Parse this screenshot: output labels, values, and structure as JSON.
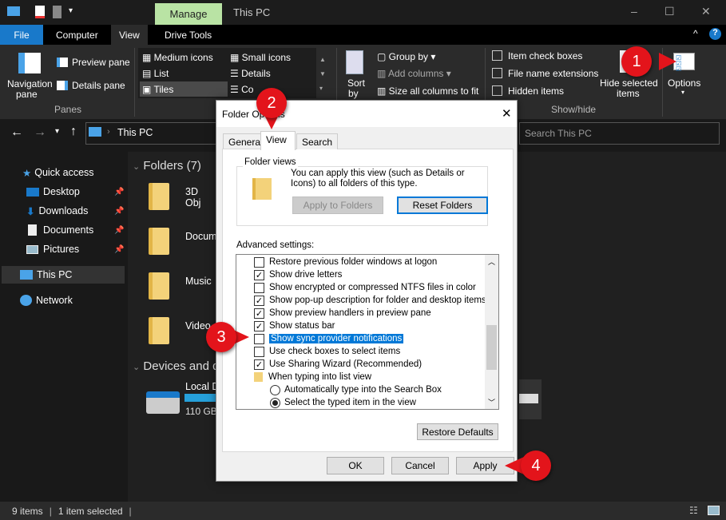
{
  "window": {
    "title": "This PC",
    "context_tab": "Manage",
    "minimize_icon": "–",
    "maximize_icon": "☐",
    "close_icon": "✕"
  },
  "ribbon_tabs": [
    {
      "label": "File"
    },
    {
      "label": "Computer"
    },
    {
      "label": "View"
    },
    {
      "label": "Drive Tools"
    }
  ],
  "ribbon": {
    "panes": {
      "navigation_pane": "Navigation",
      "navigation_pane2": "pane",
      "preview_pane": "Preview pane",
      "details_pane": "Details pane",
      "group": "Panes"
    },
    "layout": {
      "medium_icons": "Medium icons",
      "small_icons": "Small icons",
      "list": "List",
      "details": "Details",
      "tiles": "Tiles",
      "content": "Co"
    },
    "current_view": {
      "sort_by": "Sort",
      "sort_by2": "by",
      "group_by": "Group by",
      "add_columns": "Add columns",
      "size_columns": "Size all columns to fit"
    },
    "show_hide": {
      "item_check_boxes": "Item check boxes",
      "file_name_extensions": "File name extensions",
      "hidden_items": "Hidden items",
      "hide_selected": "Hide selected",
      "hide_selected2": "items",
      "group": "Show/hide"
    },
    "options": "Options"
  },
  "navigation": {
    "address": "This PC",
    "search_placeholder": "Search This PC",
    "search_visible": "s PC"
  },
  "sidebar": {
    "items": [
      {
        "label": "Quick access"
      },
      {
        "label": "Desktop"
      },
      {
        "label": "Downloads"
      },
      {
        "label": "Documents"
      },
      {
        "label": "Pictures"
      },
      {
        "label": "This PC"
      },
      {
        "label": "Network"
      }
    ]
  },
  "content": {
    "folders_header": "Folders (7)",
    "folders": [
      "3D Obj",
      "Docum",
      "Music",
      "Video"
    ],
    "devices_header": "Devices and d",
    "drive": {
      "name": "Local D",
      "size": "110 GB",
      "used_fraction": 0.7
    }
  },
  "status": {
    "items": "9 items",
    "selected": "1 item selected"
  },
  "dialog": {
    "title": "Folder Options",
    "close": "✕",
    "tabs": [
      "General",
      "View",
      "Search"
    ],
    "active_tab": "View",
    "folder_views": {
      "label": "Folder views",
      "description": "You can apply this view (such as Details or Icons) to all folders of this type.",
      "apply_button": "Apply to Folders",
      "reset_button": "Reset Folders"
    },
    "advanced_label": "Advanced settings:",
    "settings": [
      {
        "label": "Restore previous folder windows at logon",
        "type": "checkbox",
        "checked": false
      },
      {
        "label": "Show drive letters",
        "type": "checkbox",
        "checked": true
      },
      {
        "label": "Show encrypted or compressed NTFS files in color",
        "type": "checkbox",
        "checked": false
      },
      {
        "label": "Show pop-up description for folder and desktop items",
        "type": "checkbox",
        "checked": true
      },
      {
        "label": "Show preview handlers in preview pane",
        "type": "checkbox",
        "checked": true
      },
      {
        "label": "Show status bar",
        "type": "checkbox",
        "checked": true
      },
      {
        "label": "Show sync provider notifications",
        "type": "checkbox",
        "checked": false,
        "selected": true
      },
      {
        "label": "Use check boxes to select items",
        "type": "checkbox",
        "checked": false
      },
      {
        "label": "Use Sharing Wizard (Recommended)",
        "type": "checkbox",
        "checked": true
      },
      {
        "label": "When typing into list view",
        "type": "folder"
      },
      {
        "label": "Automatically type into the Search Box",
        "type": "radio",
        "checked": false
      },
      {
        "label": "Select the typed item in the view",
        "type": "radio",
        "checked": true
      }
    ],
    "restore_defaults": "Restore Defaults",
    "ok": "OK",
    "cancel": "Cancel",
    "apply": "Apply"
  },
  "markers": [
    "1",
    "2",
    "3",
    "4"
  ],
  "colors": {
    "accent": "#1979ca",
    "marker": "#e3141b",
    "manage_tab": "#b9e3a4",
    "selection": "#0078d7"
  }
}
